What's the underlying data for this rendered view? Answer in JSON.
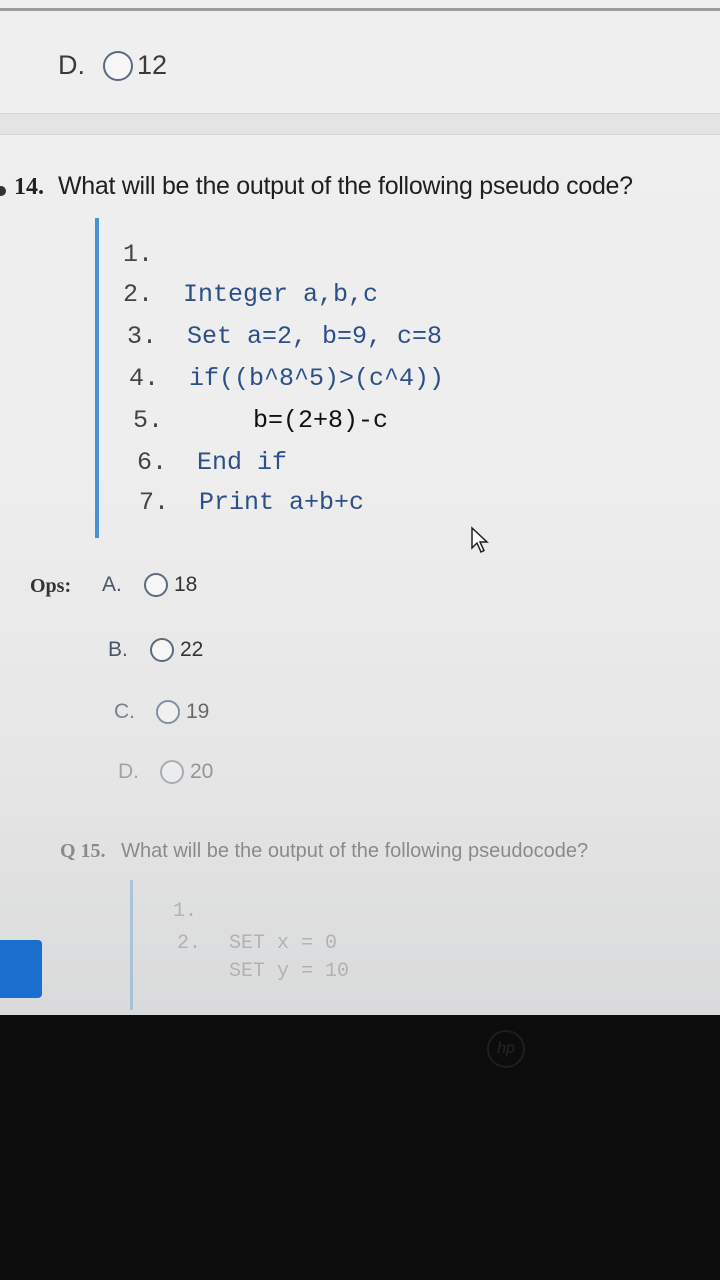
{
  "previous_question": {
    "option_letter": "D.",
    "option_value": "12"
  },
  "question": {
    "number": "14.",
    "text": "What will be the output of the following pseudo code?",
    "code_lines": [
      {
        "num": "1.",
        "text": ""
      },
      {
        "num": "2.",
        "text": "Integer a,b,c"
      },
      {
        "num": "3.",
        "text": "Set a=2, b=9, c=8"
      },
      {
        "num": "4.",
        "text": "if((b^8^5)>(c^4))"
      },
      {
        "num": "5.",
        "text": "b=(2+8)-c"
      },
      {
        "num": "6.",
        "text": "End if"
      },
      {
        "num": "7.",
        "text": "Print a+b+c"
      }
    ]
  },
  "options": {
    "label": "Ops:",
    "items": [
      {
        "letter": "A.",
        "value": "18"
      },
      {
        "letter": "B.",
        "value": "22"
      },
      {
        "letter": "C.",
        "value": "19"
      },
      {
        "letter": "D.",
        "value": "20"
      }
    ]
  },
  "next_question": {
    "number": "Q 15.",
    "text": "What will be the output of the following pseudocode?",
    "code_fragments": [
      "1.",
      "2.",
      "SET x = 0",
      "SET y = 10"
    ]
  },
  "colors": {
    "accent_bar": "#4b8fd6",
    "number_red": "#c0392b",
    "keyword_blue": "#2c4f8a"
  },
  "icons": {
    "cursor": "mouse-pointer-icon",
    "logo": "hp-logo-icon"
  }
}
